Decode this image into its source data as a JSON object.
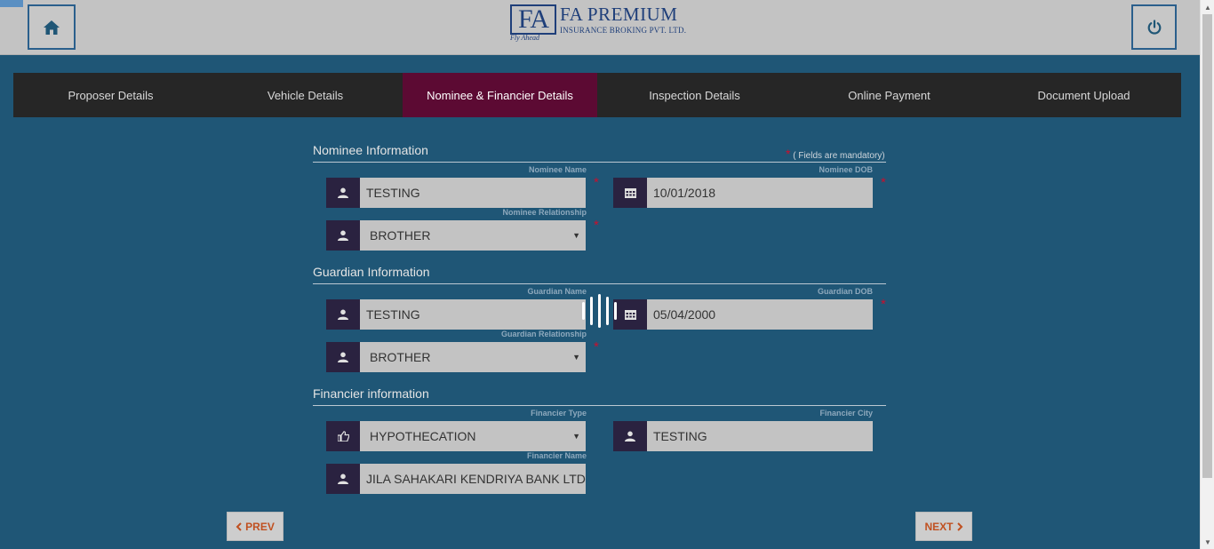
{
  "header": {
    "logo_mark": "FA",
    "logo_tagline": "Fly Ahead",
    "logo_title": "FA PREMIUM",
    "logo_subtitle": "INSURANCE BROKING PVT. LTD."
  },
  "tabs": [
    {
      "label": "Proposer Details",
      "active": false
    },
    {
      "label": "Vehicle Details",
      "active": false
    },
    {
      "label": "Nominee & Financier Details",
      "active": true
    },
    {
      "label": "Inspection Details",
      "active": false
    },
    {
      "label": "Online Payment",
      "active": false
    },
    {
      "label": "Document Upload",
      "active": false
    }
  ],
  "form": {
    "mandatory_star": "*",
    "mandatory_note": "( Fields are mandatory)",
    "nominee": {
      "title": "Nominee Information",
      "name_label": "Nominee Name",
      "name_value": "TESTING",
      "dob_label": "Nominee DOB",
      "dob_value": "10/01/2018",
      "relationship_label": "Nominee Relationship",
      "relationship_value": "BROTHER"
    },
    "guardian": {
      "title": "Guardian Information",
      "name_label": "Guardian Name",
      "name_value": "TESTING",
      "dob_label": "Guardian DOB",
      "dob_value": "05/04/2000",
      "relationship_label": "Guardian Relationship",
      "relationship_value": "BROTHER"
    },
    "financier": {
      "title": "Financier information",
      "type_label": "Financier Type",
      "type_value": "HYPOTHECATION",
      "city_label": "Financier City",
      "city_value": "TESTING",
      "name_label": "Financier Name",
      "name_value": "JILA SAHAKARI KENDRIYA BANK LTD"
    }
  },
  "buttons": {
    "prev": "PREV",
    "next": "NEXT"
  },
  "colors": {
    "page_bg": "#1f5676",
    "header_bg": "#c3c3c3",
    "tab_bar": "#262626",
    "tab_active": "#5c0a33",
    "required": "#c8102e",
    "nav_text": "#c05020"
  }
}
